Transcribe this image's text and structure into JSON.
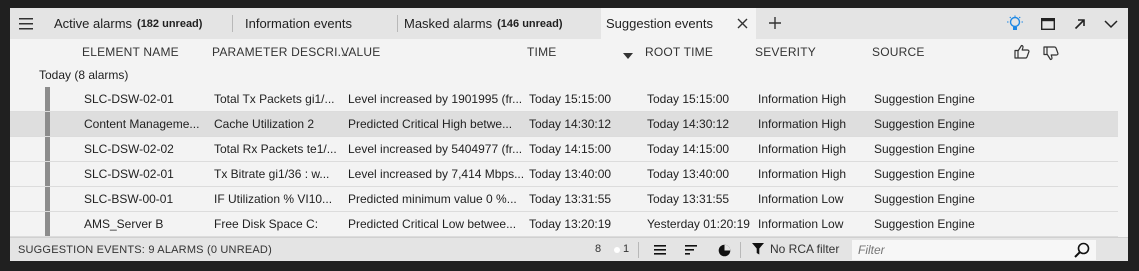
{
  "tabs": [
    {
      "label": "Active alarms",
      "badge": "(182 unread)"
    },
    {
      "label": "Information events",
      "badge": ""
    },
    {
      "label": "Masked alarms",
      "badge": "(146 unread)"
    },
    {
      "label": "Suggestion events",
      "badge": ""
    }
  ],
  "columns": {
    "element": "ELEMENT NAME",
    "parameter": "PARAMETER DESCRI...",
    "value": "VALUE",
    "time": "TIME",
    "root_time": "ROOT TIME",
    "severity": "SEVERITY",
    "source": "SOURCE"
  },
  "group_label": "Today (8 alarms)",
  "rows": [
    {
      "element": "SLC-DSW-02-01",
      "parameter": "Total Tx Packets gi1/...",
      "value": "Level increased by 1901995 (fr...",
      "time": "Today 15:15:00",
      "root_time": "Today 15:15:00",
      "severity": "Information High",
      "source": "Suggestion Engine"
    },
    {
      "element": "Content Manageme...",
      "parameter": "Cache Utilization 2",
      "value": "Predicted Critical High betwe...",
      "time": "Today 14:30:12",
      "root_time": "Today 14:30:12",
      "severity": "Information High",
      "source": "Suggestion Engine"
    },
    {
      "element": "SLC-DSW-02-02",
      "parameter": "Total Rx Packets te1/...",
      "value": "Level increased by 5404977 (fr...",
      "time": "Today 14:15:00",
      "root_time": "Today 14:15:00",
      "severity": "Information High",
      "source": "Suggestion Engine"
    },
    {
      "element": "SLC-DSW-02-01",
      "parameter": "Tx Bitrate gi1/36 : w...",
      "value": "Level increased by 7,414 Mbps...",
      "time": "Today 13:40:00",
      "root_time": "Today 13:40:00",
      "severity": "Information High",
      "source": "Suggestion Engine"
    },
    {
      "element": "SLC-BSW-00-01",
      "parameter": "IF Utilization % VI10...",
      "value": "Predicted minimum value 0 %...",
      "time": "Today 13:31:55",
      "root_time": "Today 13:31:55",
      "severity": "Information Low",
      "source": "Suggestion Engine"
    },
    {
      "element": "AMS_Server B",
      "parameter": "Free Disk Space C:",
      "value": "Predicted Critical Low betwee...",
      "time": "Today 13:20:19",
      "root_time": "Yesterday 01:20:19",
      "severity": "Information Low",
      "source": "Suggestion Engine"
    }
  ],
  "status": {
    "label": "SUGGESTION EVENTS: 9 ALARMS (0 UNREAD)",
    "count_a": "8",
    "count_b": "1",
    "rca": "No RCA filter",
    "filter_placeholder": "Filter"
  },
  "icons": [
    "hamburger-icon",
    "close-icon",
    "plus-icon",
    "lightbulb-icon",
    "maximize-icon",
    "detach-icon",
    "chevron-down-icon",
    "thumbs-up-icon",
    "thumbs-down-icon",
    "sort-desc-icon",
    "list-icon",
    "sort-icon",
    "pie-chart-icon",
    "funnel-icon",
    "search-icon"
  ],
  "colors": {
    "accent": "#1e88e5",
    "stripe": "#8c8c8c",
    "selected_row": "#dedede"
  }
}
